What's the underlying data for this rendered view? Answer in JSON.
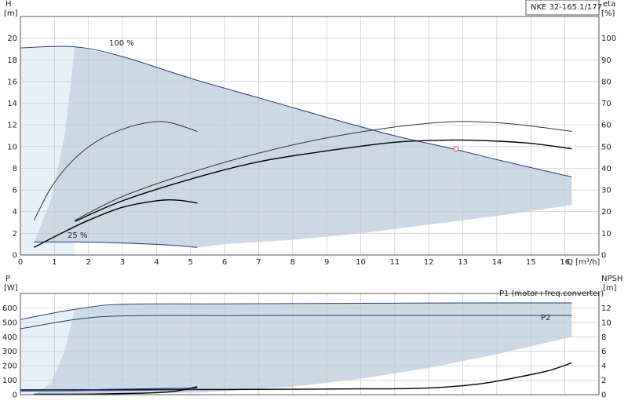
{
  "chart_data": [
    {
      "type": "line",
      "panel": "head_efficiency",
      "title_box": "NKE 32-165.1/177",
      "left_axis": {
        "label_top": "H",
        "label_unit": "[m]",
        "ticks": [
          "0",
          "2",
          "4",
          "6",
          "8",
          "10",
          "12",
          "14",
          "16",
          "18",
          "20"
        ],
        "range": [
          0,
          22
        ]
      },
      "right_axis": {
        "label_top": "eta",
        "label_unit": "[%]",
        "ticks": [
          "0",
          "10",
          "20",
          "30",
          "40",
          "50",
          "60",
          "70",
          "80",
          "90",
          "100"
        ],
        "range": [
          0,
          110
        ]
      },
      "x_axis": {
        "label": "Q [m³/h]",
        "ticks": [
          "0",
          "1",
          "2",
          "3",
          "4",
          "5",
          "6",
          "7",
          "8",
          "9",
          "10",
          "11",
          "12",
          "13",
          "14",
          "15",
          "16"
        ],
        "range": [
          0,
          17
        ]
      },
      "curve_labels": {
        "max_speed": "100 %",
        "min_speed": "25 %"
      },
      "grid": true,
      "operating_region": {
        "outer_light": [
          [
            0,
            19.1
          ],
          [
            1.6,
            19.2
          ],
          [
            1.6,
            0
          ],
          [
            0,
            0
          ]
        ],
        "dark": [
          [
            0.4,
            1.2
          ],
          [
            0.9,
            5
          ],
          [
            1.3,
            11
          ],
          [
            1.6,
            19.2
          ],
          [
            3,
            18.3
          ],
          [
            5,
            16.3
          ],
          [
            7,
            14.5
          ],
          [
            9,
            12.7
          ],
          [
            11,
            11
          ],
          [
            12.7,
            9.8
          ],
          [
            14,
            8.8
          ],
          [
            16.2,
            7.2
          ],
          [
            16.2,
            4.6
          ],
          [
            14,
            3.6
          ],
          [
            12,
            2.8
          ],
          [
            10,
            2
          ],
          [
            8,
            1.4
          ],
          [
            6,
            1
          ],
          [
            5.2,
            0.7
          ],
          [
            3,
            1.1
          ],
          [
            1.6,
            1.2
          ]
        ]
      },
      "series": [
        {
          "role": "max_curve",
          "color": "#1f3f7a",
          "points": [
            [
              0,
              19.1
            ],
            [
              1.6,
              19.2
            ],
            [
              3,
              18.3
            ],
            [
              5,
              16.3
            ],
            [
              7,
              14.5
            ],
            [
              9,
              12.7
            ],
            [
              11,
              11
            ],
            [
              12.7,
              9.8
            ],
            [
              14,
              8.8
            ],
            [
              16.2,
              7.2
            ]
          ]
        },
        {
          "role": "min_curve",
          "color": "#1f3f7a",
          "points": [
            [
              0.4,
              1.2
            ],
            [
              1.6,
              1.2
            ],
            [
              3,
              1.1
            ],
            [
              4.2,
              0.95
            ],
            [
              5.2,
              0.7
            ]
          ]
        },
        {
          "role": "eta_overall",
          "axis": "right",
          "color": "#000000",
          "points": [
            [
              1.6,
              15.5
            ],
            [
              3,
              25
            ],
            [
              5,
              35
            ],
            [
              7,
              43
            ],
            [
              9,
              48
            ],
            [
              11,
              52
            ],
            [
              12.7,
              53
            ],
            [
              14,
              52.5
            ],
            [
              15,
              51.5
            ],
            [
              16.2,
              49
            ]
          ]
        },
        {
          "role": "eta_pump",
          "axis": "right",
          "color": "#333333",
          "points": [
            [
              1.6,
              16
            ],
            [
              3,
              27
            ],
            [
              5,
              38
            ],
            [
              7,
              47
            ],
            [
              9,
              54
            ],
            [
              11,
              59
            ],
            [
              12.7,
              61.5
            ],
            [
              14,
              61
            ],
            [
              15,
              59.5
            ],
            [
              16.2,
              57
            ]
          ]
        },
        {
          "role": "eta_low_speed_pump",
          "axis": "right",
          "color": "#333333",
          "points": [
            [
              0.4,
              16
            ],
            [
              0.9,
              31
            ],
            [
              1.5,
              43
            ],
            [
              2.2,
              52
            ],
            [
              3,
              58
            ],
            [
              3.8,
              61.2
            ],
            [
              4.4,
              61
            ],
            [
              5.2,
              57
            ]
          ]
        },
        {
          "role": "eta_low_speed_overall",
          "axis": "right",
          "color": "#000000",
          "points": [
            [
              0.4,
              3.5
            ],
            [
              1.2,
              10
            ],
            [
              2,
              16
            ],
            [
              3,
              22
            ],
            [
              4,
              25
            ],
            [
              4.6,
              25.3
            ],
            [
              5.2,
              24
            ]
          ]
        }
      ],
      "duty_point": {
        "x": 12.8,
        "y": 9.8
      }
    },
    {
      "type": "line",
      "panel": "power_npsh",
      "left_axis": {
        "label_top": "P",
        "label_unit": "[W]",
        "ticks": [
          "0",
          "100",
          "200",
          "300",
          "400",
          "500",
          "600"
        ],
        "range": [
          0,
          700
        ]
      },
      "right_axis": {
        "label_top": "NPSH",
        "label_unit": "[m]",
        "ticks": [
          "0",
          "2",
          "4",
          "6",
          "8",
          "10",
          "12"
        ],
        "range": [
          0,
          14
        ]
      },
      "x_axis": {
        "range": [
          0,
          17
        ]
      },
      "grid": true,
      "operating_region": {
        "outer_light": [
          [
            0,
            520
          ],
          [
            1.6,
            590
          ],
          [
            1.6,
            0
          ],
          [
            0,
            0
          ]
        ],
        "dark": [
          [
            0.4,
            0
          ],
          [
            0.9,
            80
          ],
          [
            1.3,
            300
          ],
          [
            1.6,
            590
          ],
          [
            3,
            625
          ],
          [
            16.2,
            635
          ],
          [
            16.2,
            400
          ],
          [
            14,
            280
          ],
          [
            12,
            185
          ],
          [
            10,
            110
          ],
          [
            8,
            55
          ],
          [
            6,
            25
          ],
          [
            5.2,
            15
          ],
          [
            3,
            5
          ],
          [
            1.6,
            0
          ]
        ]
      },
      "series_labels": {
        "p1": "P1 (motor+freq.converter)",
        "p2": "P2"
      },
      "series": [
        {
          "role": "p1",
          "color": "#1f3f7a",
          "points": [
            [
              0,
              520
            ],
            [
              1.6,
              590
            ],
            [
              3,
              625
            ],
            [
              6,
              628
            ],
            [
              10,
              632
            ],
            [
              14,
              635
            ],
            [
              16.2,
              635
            ]
          ]
        },
        {
          "role": "p2",
          "color": "#1f3f7a",
          "points": [
            [
              0,
              455
            ],
            [
              1.6,
              520
            ],
            [
              3,
              545
            ],
            [
              6,
              547
            ],
            [
              10,
              548
            ],
            [
              14,
              548
            ],
            [
              16.2,
              548
            ]
          ]
        },
        {
          "role": "npsh",
          "axis": "right",
          "color": "#000000",
          "points": [
            [
              0,
              0.65
            ],
            [
              3,
              0.7
            ],
            [
              6,
              0.72
            ],
            [
              8,
              0.75
            ],
            [
              10,
              0.8
            ],
            [
              11.5,
              0.85
            ],
            [
              12.5,
              1.05
            ],
            [
              13.5,
              1.5
            ],
            [
              14.5,
              2.3
            ],
            [
              15.5,
              3.3
            ],
            [
              16.2,
              4.4
            ]
          ]
        },
        {
          "role": "p1_low_speed",
          "color": "#1f3f7a",
          "points": [
            [
              0,
              30
            ],
            [
              2,
              35
            ],
            [
              4,
              42
            ],
            [
              5.2,
              45
            ]
          ]
        },
        {
          "role": "p2_low_speed",
          "color": "#1f3f7a",
          "points": [
            [
              0,
              25
            ],
            [
              2,
              28
            ],
            [
              4,
              32
            ],
            [
              5.2,
              35
            ]
          ]
        },
        {
          "role": "npsh_low_speed",
          "axis": "right",
          "color": "#000000",
          "points": [
            [
              0.4,
              0.05
            ],
            [
              2,
              0.08
            ],
            [
              3.5,
              0.2
            ],
            [
              4.5,
              0.45
            ],
            [
              5.2,
              1.1
            ]
          ]
        }
      ]
    }
  ]
}
